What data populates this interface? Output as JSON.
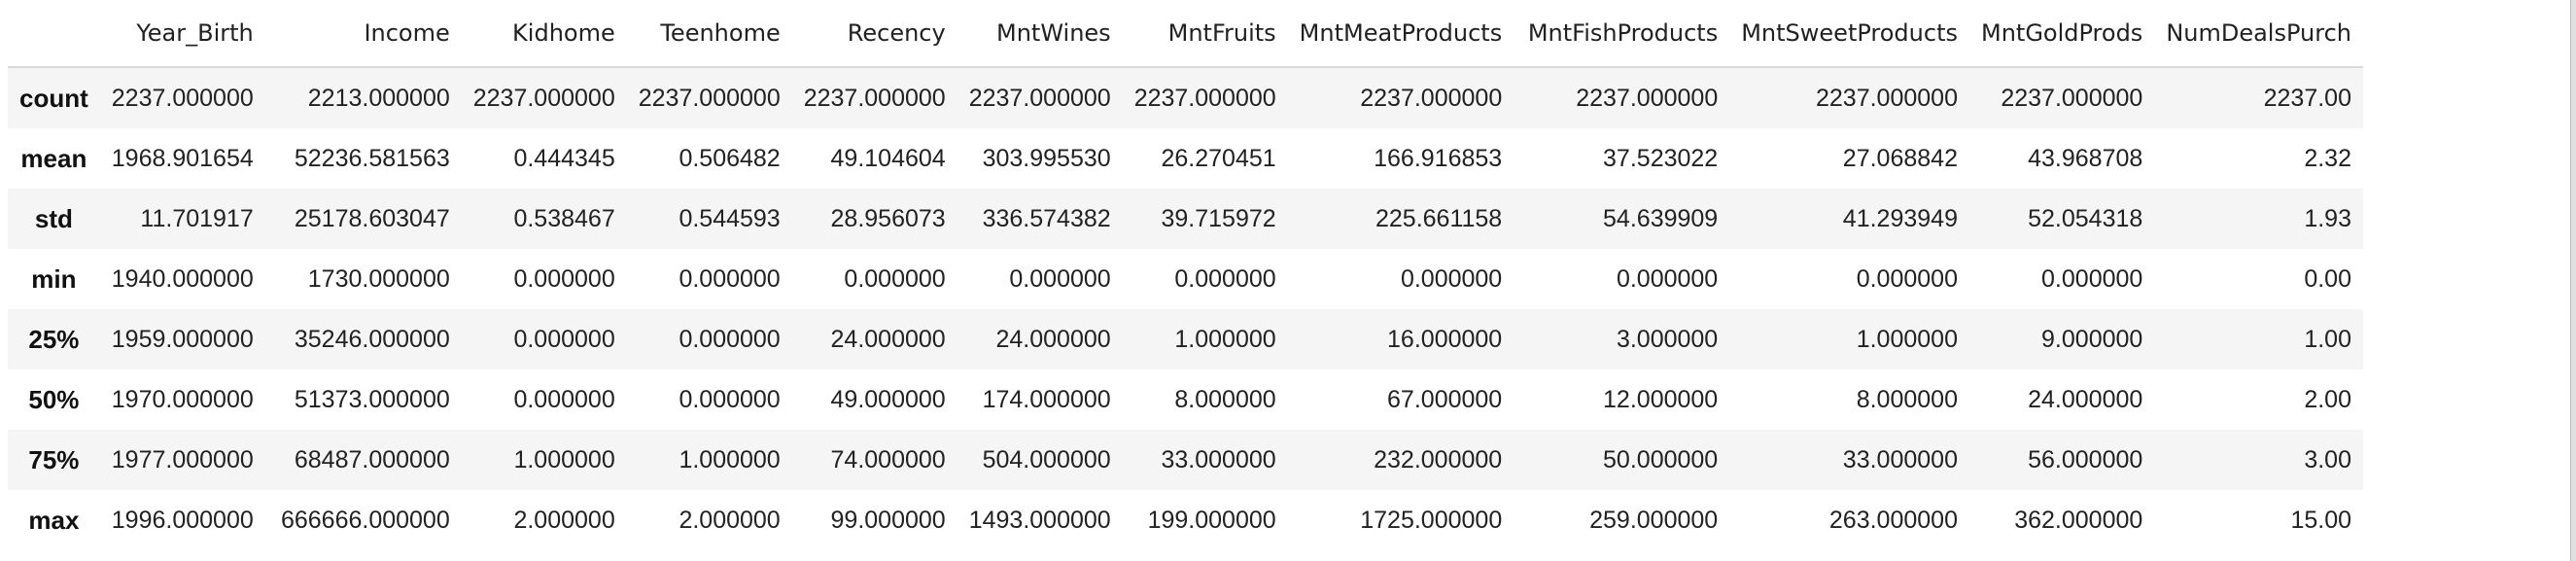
{
  "table": {
    "index_header": "",
    "columns": [
      "Year_Birth",
      "Income",
      "Kidhome",
      "Teenhome",
      "Recency",
      "MntWines",
      "MntFruits",
      "MntMeatProducts",
      "MntFishProducts",
      "MntSweetProducts",
      "MntGoldProds",
      "NumDealsPurch"
    ],
    "rows": [
      {
        "label": "count",
        "cells": [
          "2237.000000",
          "2213.000000",
          "2237.000000",
          "2237.000000",
          "2237.000000",
          "2237.000000",
          "2237.000000",
          "2237.000000",
          "2237.000000",
          "2237.000000",
          "2237.000000",
          "2237.00"
        ]
      },
      {
        "label": "mean",
        "cells": [
          "1968.901654",
          "52236.581563",
          "0.444345",
          "0.506482",
          "49.104604",
          "303.995530",
          "26.270451",
          "166.916853",
          "37.523022",
          "27.068842",
          "43.968708",
          "2.32"
        ]
      },
      {
        "label": "std",
        "cells": [
          "11.701917",
          "25178.603047",
          "0.538467",
          "0.544593",
          "28.956073",
          "336.574382",
          "39.715972",
          "225.661158",
          "54.639909",
          "41.293949",
          "52.054318",
          "1.93"
        ]
      },
      {
        "label": "min",
        "cells": [
          "1940.000000",
          "1730.000000",
          "0.000000",
          "0.000000",
          "0.000000",
          "0.000000",
          "0.000000",
          "0.000000",
          "0.000000",
          "0.000000",
          "0.000000",
          "0.00"
        ]
      },
      {
        "label": "25%",
        "cells": [
          "1959.000000",
          "35246.000000",
          "0.000000",
          "0.000000",
          "24.000000",
          "24.000000",
          "1.000000",
          "16.000000",
          "3.000000",
          "1.000000",
          "9.000000",
          "1.00"
        ]
      },
      {
        "label": "50%",
        "cells": [
          "1970.000000",
          "51373.000000",
          "0.000000",
          "0.000000",
          "49.000000",
          "174.000000",
          "8.000000",
          "67.000000",
          "12.000000",
          "8.000000",
          "24.000000",
          "2.00"
        ]
      },
      {
        "label": "75%",
        "cells": [
          "1977.000000",
          "68487.000000",
          "1.000000",
          "1.000000",
          "74.000000",
          "504.000000",
          "33.000000",
          "232.000000",
          "50.000000",
          "33.000000",
          "56.000000",
          "3.00"
        ]
      },
      {
        "label": "max",
        "cells": [
          "1996.000000",
          "666666.000000",
          "2.000000",
          "2.000000",
          "99.000000",
          "1493.000000",
          "199.000000",
          "1725.000000",
          "259.000000",
          "263.000000",
          "362.000000",
          "15.00"
        ]
      }
    ]
  }
}
